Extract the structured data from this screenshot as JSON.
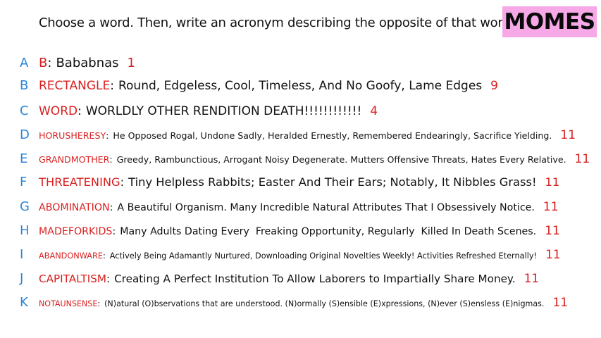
{
  "prompt": "Choose a word. Then, write an acronym describing the opposite of that word!",
  "brand": "MOMES",
  "entries": [
    {
      "letter": "A",
      "word": "B",
      "description": "Bababnas",
      "score": "1"
    },
    {
      "letter": "B",
      "word": "RECTANGLE",
      "description": "Round, Edgeless, Cool, Timeless, And No Goofy, Lame Edges",
      "score": "9"
    },
    {
      "letter": "C",
      "word": "WORD",
      "description": "WORLDLY OTHER RENDITION DEATH!!!!!!!!!!!!",
      "score": "4"
    },
    {
      "letter": "D",
      "word": "HORUSHERESY",
      "description": "He Opposed Rogal, Undone Sadly, Heralded Ernestly, Remembered Endearingly, Sacrifice Yielding.",
      "score": "11"
    },
    {
      "letter": "E",
      "word": "GRANDMOTHER",
      "description": "Greedy, Rambunctious, Arrogant Noisy Degenerate. Mutters Offensive Threats, Hates Every Relative.",
      "score": "11"
    },
    {
      "letter": "F",
      "word": "THREATENING",
      "description": "Tiny Helpless Rabbits; Easter And Their Ears; Notably, It Nibbles Grass!",
      "score": "11"
    },
    {
      "letter": "G",
      "word": "ABOMINATION",
      "description": "A Beautiful Organism. Many Incredible Natural Attributes That I Obsessively Notice.",
      "score": "11"
    },
    {
      "letter": "H",
      "word": "MADEFORKIDS",
      "description": "Many Adults Dating Every  Freaking Opportunity, Regularly  Killed In Death Scenes.",
      "score": "11"
    },
    {
      "letter": "I",
      "word": "ABANDONWARE",
      "description": "Actively Being Adamantly Nurtured, Downloading Original Novelties Weekly! Activities Refreshed Eternally!",
      "score": "11"
    },
    {
      "letter": "J",
      "word": "CAPITALTISM",
      "description": "Creating A Perfect Institution To Allow Laborers to Impartially Share Money.",
      "score": "11"
    },
    {
      "letter": "K",
      "word": "NOTAUNSENSE",
      "description": "(N)atural (O)bservations that are understood. (N)ormally (S)ensible (E)xpressions, (N)ever (S)ensless (E)nigmas.",
      "score": "11"
    }
  ]
}
